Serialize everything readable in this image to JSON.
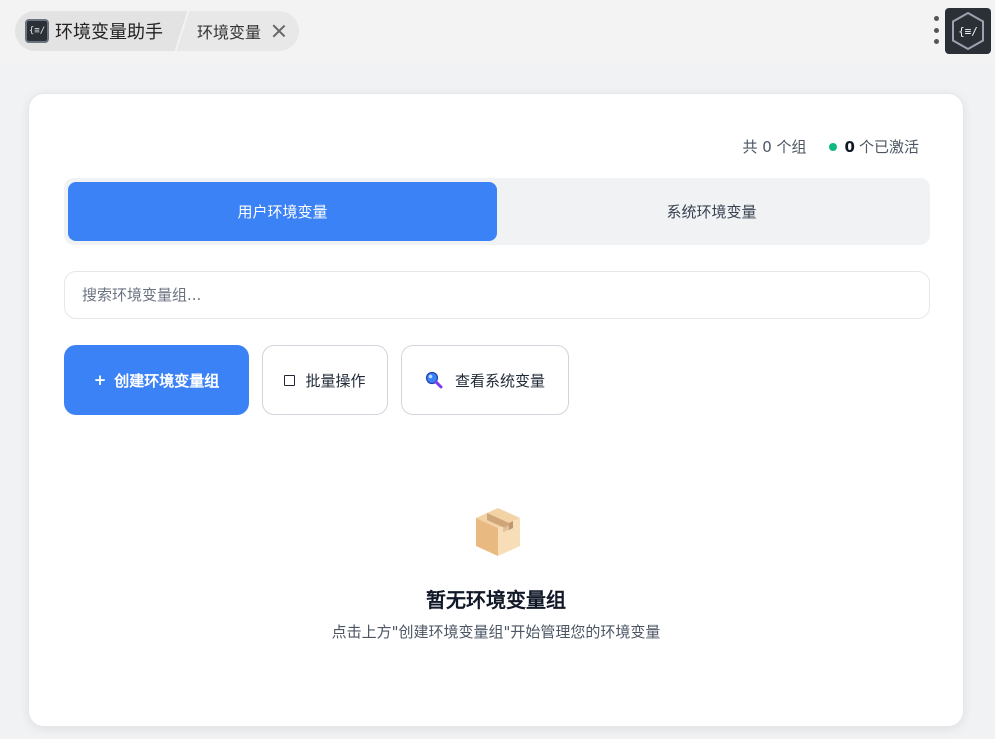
{
  "window": {
    "app_tab_label": "环境变量助手",
    "page_tab_label": "环境变量",
    "logo_text": "{≡/"
  },
  "stats": {
    "group_count_text": "共 0 个组",
    "active_count": "0",
    "active_suffix": "个已激活",
    "active_dot_color": "#10b981"
  },
  "tabs": [
    {
      "label": "用户环境变量",
      "active": true
    },
    {
      "label": "系统环境变量",
      "active": false
    }
  ],
  "search": {
    "placeholder": "搜索环境变量组...",
    "value": ""
  },
  "actions": {
    "create_plus": "+",
    "create_label": "创建环境变量组",
    "batch_label": "批量操作",
    "view_system_label": "查看系统变量"
  },
  "empty_state": {
    "icon": "package-box-icon",
    "title": "暂无环境变量组",
    "description": "点击上方\"创建环境变量组\"开始管理您的环境变量"
  },
  "colors": {
    "accent": "#3b82f6",
    "success": "#10b981"
  }
}
